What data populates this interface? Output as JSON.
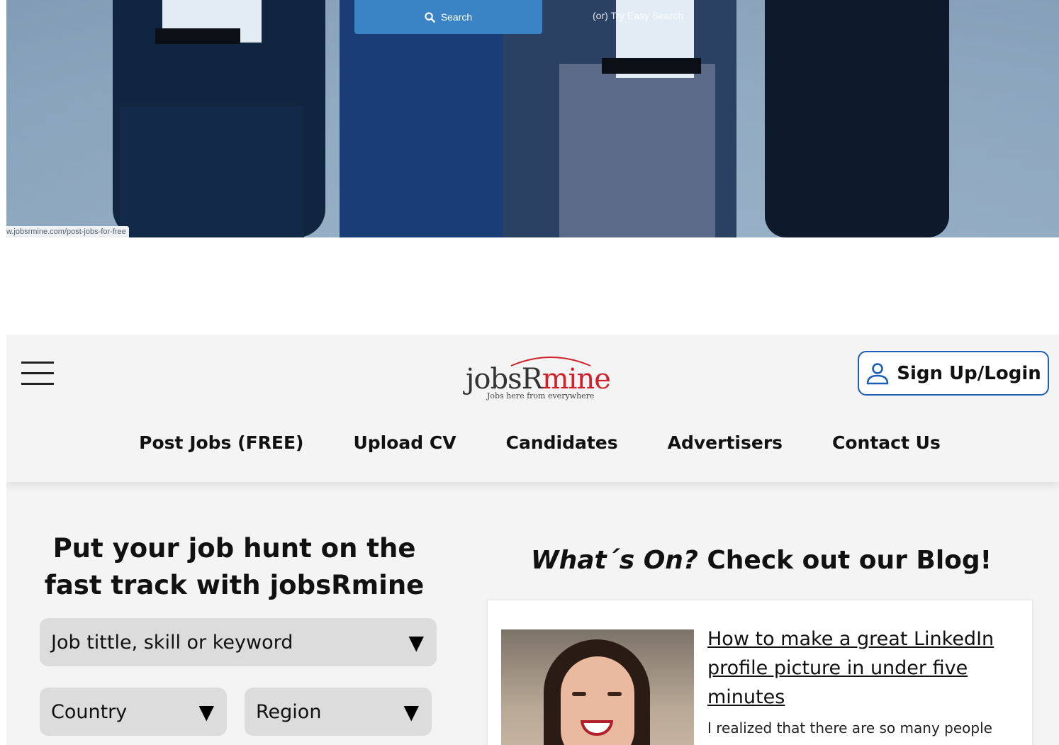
{
  "hero": {
    "search_label": "Search",
    "easy_search_label": "(or) Try Easy Search",
    "status_url": "w.jobsrmine.com/post-jobs-for-free"
  },
  "header": {
    "logo_text_dark": "jobsR",
    "logo_text_red": "mine",
    "logo_tagline": "Jobs here from everywhere",
    "signup_label": "Sign Up/Login",
    "nav": [
      "Post Jobs (FREE)",
      "Upload CV",
      "Candidates",
      "Advertisers",
      "Contact Us"
    ]
  },
  "hunt": {
    "title": "Put your job hunt on the fast track with jobsRmine",
    "keyword_placeholder": "Job tittle, skill or keyword",
    "country_placeholder": "Country",
    "region_placeholder": "Region"
  },
  "blog": {
    "title_italic": "What´s On?",
    "title_rest": " Check out our Blog!",
    "post_title": "How to make a great LinkedIn profile picture in under five minutes",
    "post_excerpt": "I realized that there are so many people"
  },
  "colors": {
    "accent_blue": "#1d5fb8",
    "hero_button": "#3a84c6",
    "logo_red": "#d0202a",
    "page_bg": "#f4f4f4",
    "select_bg": "#dcdcdc"
  },
  "icons": {
    "search": "magnifier-icon",
    "user": "user-outline-icon",
    "menu": "hamburger-icon",
    "dropdown": "triangle-down-icon"
  }
}
